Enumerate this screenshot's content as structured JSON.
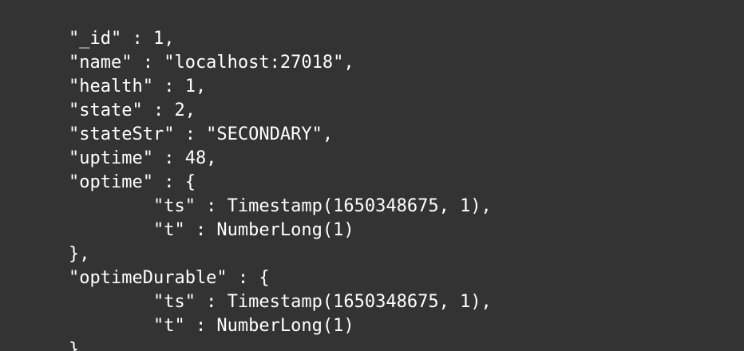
{
  "colors": {
    "background": "#333333",
    "text": "#ffffff"
  },
  "output": {
    "lines": [
      "\"_id\" : 1,",
      "\"name\" : \"localhost:27018\",",
      "\"health\" : 1,",
      "\"state\" : 2,",
      "\"stateStr\" : \"SECONDARY\",",
      "\"uptime\" : 48,",
      "\"optime\" : {",
      "        \"ts\" : Timestamp(1650348675, 1),",
      "        \"t\" : NumberLong(1)",
      "},",
      "\"optimeDurable\" : {",
      "        \"ts\" : Timestamp(1650348675, 1),",
      "        \"t\" : NumberLong(1)",
      "},"
    ]
  }
}
